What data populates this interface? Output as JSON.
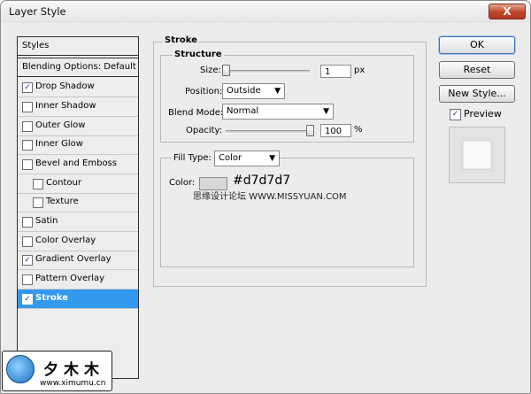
{
  "window": {
    "title": "Layer Style",
    "close_label": "X"
  },
  "styles_list": {
    "header": "Styles",
    "blending": "Blending Options: Default",
    "items": [
      {
        "label": "Drop Shadow",
        "checked": true
      },
      {
        "label": "Inner Shadow",
        "checked": false
      },
      {
        "label": "Outer Glow",
        "checked": false
      },
      {
        "label": "Inner Glow",
        "checked": false
      },
      {
        "label": "Bevel and Emboss",
        "checked": false
      },
      {
        "label": "Contour",
        "checked": false
      },
      {
        "label": "Texture",
        "checked": false
      },
      {
        "label": "Satin",
        "checked": false
      },
      {
        "label": "Color Overlay",
        "checked": false
      },
      {
        "label": "Gradient Overlay",
        "checked": true
      },
      {
        "label": "Pattern Overlay",
        "checked": false
      },
      {
        "label": "Stroke",
        "checked": true
      }
    ]
  },
  "stroke": {
    "group_label": "Stroke",
    "structure": {
      "label": "Structure",
      "size_label": "Size:",
      "size_value": "1",
      "size_unit": "px",
      "position_label": "Position:",
      "position_value": "Outside",
      "blend_mode_label": "Blend Mode:",
      "blend_mode_value": "Normal",
      "opacity_label": "Opacity:",
      "opacity_value": "100",
      "opacity_unit": "%"
    },
    "fill": {
      "fill_type_label": "Fill Type:",
      "fill_type_value": "Color",
      "color_label": "Color:",
      "color_hex": "#d7d7d7",
      "watermark_text": "思缘设计论坛  WWW.MISSYUAN.COM"
    }
  },
  "buttons": {
    "ok": "OK",
    "reset": "Reset",
    "new_style": "New Style...",
    "preview": "Preview",
    "preview_checked": true
  },
  "logo": {
    "cn_text": "夕木木",
    "url": "www.ximumu.cn"
  },
  "colors": {
    "selection": "#3399ee",
    "dialog_bg": "#ececec",
    "swatch": "#d7d7d7"
  }
}
